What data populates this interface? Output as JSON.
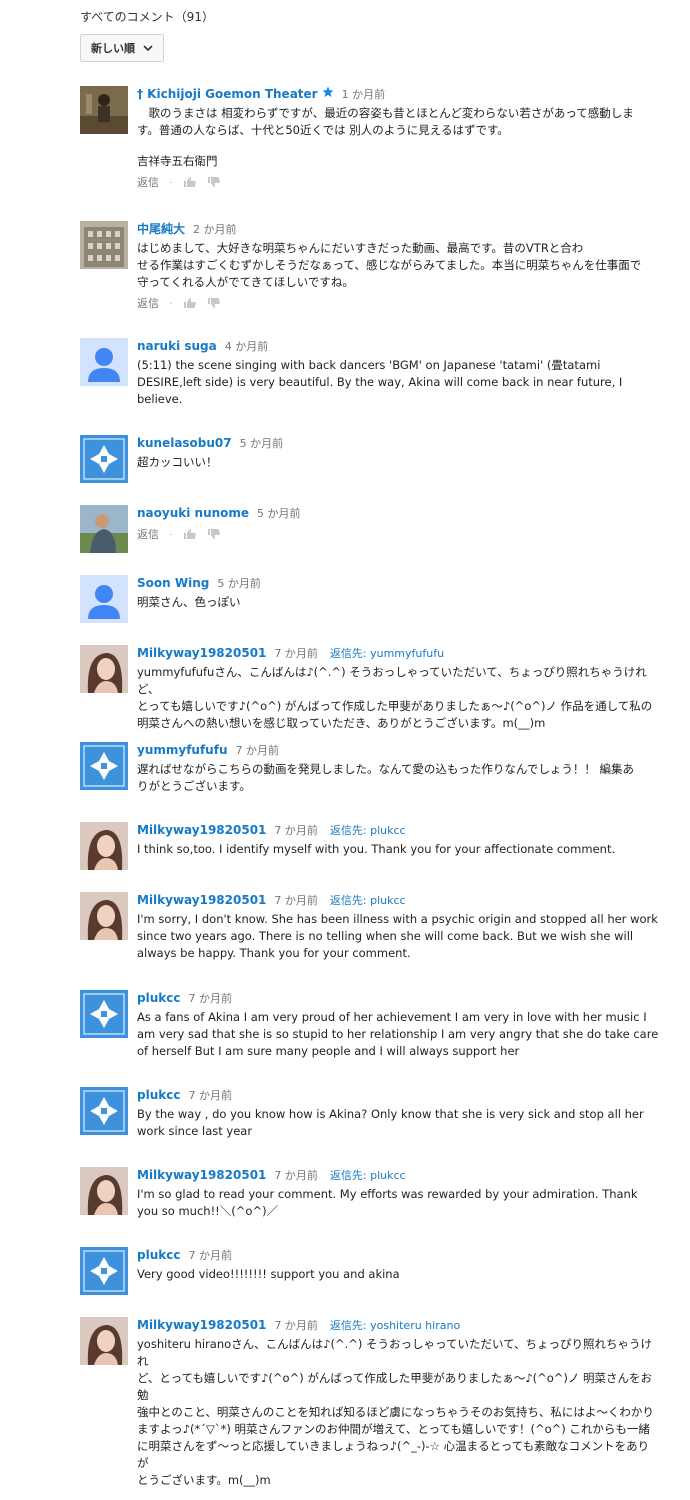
{
  "header": {
    "title": "すべてのコメント（91）"
  },
  "sort": {
    "label": "新しい順"
  },
  "actions": {
    "reply_label": "返信",
    "dot": "·"
  },
  "colors": {
    "link": "#167ac6",
    "avatar_blue": "#4285f4",
    "avatar_box": "#3e92dc"
  },
  "comments": [
    {
      "author": "† Kichijoji Goemon Theater",
      "time": "1 か月前",
      "avatar": "photo-stage",
      "lines": [
        "　歌のうまさは 相変わらずですが、最近の容姿も昔とほとんど変わらない若さがあって感動しま",
        "す。普通の人ならば、十代と50近くでは 別人のように見えるはずです。",
        "",
        "吉祥寺五右衛門"
      ]
    },
    {
      "author": "中尾純大",
      "time": "2 か月前",
      "avatar": "photo-building",
      "lines": [
        "はじめまして、大好きな明菜ちゃんにだいすきだった動画、最高です。昔のVTRと合わ",
        "せる作業はすごくむずかしそうだなぁって、感じながらみてました。本当に明菜ちゃんを仕事面で",
        "守ってくれる人がでてきてほしいですね。"
      ]
    },
    {
      "author": "naruki suga",
      "time": "4 か月前",
      "avatar": "default-user",
      "lines": [
        "(5:11) the scene singing with back dancers 'BGM' on Japanese 'tatami' (畳tatami",
        "DESIRE,left side) is very beautiful. By the way, Akina will come back in near future, I",
        "believe."
      ]
    },
    {
      "author": "kunelasobu07",
      "time": "5 か月前",
      "avatar": "default-box",
      "lines": [
        "超カッコいい！"
      ]
    },
    {
      "author": "naoyuki nunome",
      "time": "5 か月前",
      "avatar": "photo-outdoor",
      "lines": []
    },
    {
      "author": "Soon Wing",
      "time": "5 か月前",
      "avatar": "default-user",
      "lines": [
        "明菜さん、色っぽい"
      ]
    },
    {
      "author": "Milkyway19820501",
      "time": "7 か月前",
      "reply_to": "返信先: yummyfufufu",
      "avatar": "photo-portrait",
      "lines": [
        "yummyfufufuさん、こんばんは♪(^.^) そうおっしゃっていただいて、ちょっぴり照れちゃうけれど、",
        "とっても嬉しいです♪(^o^) がんばって作成した甲斐がありましたぁ〜♪(^o^)ノ 作品を通して私の",
        "明菜さんへの熱い想いを感じ取っていただき、ありがとうございます。m(__)m"
      ]
    },
    {
      "author": "yummyfufufu",
      "time": "7 か月前",
      "avatar": "default-box",
      "lines": [
        "遅ればせながらこちらの動画を発見しました。なんて愛の込もった作りなんでしょう！！ 編集あ",
        "りがとうございます。"
      ]
    },
    {
      "author": "Milkyway19820501",
      "time": "7 か月前",
      "reply_to": "返信先: plukcc",
      "avatar": "photo-portrait",
      "lines": [
        "I think so,too. I identify myself with you. Thank you for your affectionate comment."
      ]
    },
    {
      "author": "Milkyway19820501",
      "time": "7 か月前",
      "reply_to": "返信先: plukcc",
      "avatar": "photo-portrait",
      "lines": [
        "I'm sorry, I don't know. She has been illness with a psychic origin and stopped all her work",
        "since two years ago. There is no telling when she will come back. But we wish she will",
        "always be happy. Thank you for your comment."
      ]
    },
    {
      "author": "plukcc",
      "time": "7 か月前",
      "avatar": "default-box",
      "lines": [
        "As a fans of Akina I am very proud of her achievement I am very in love with her music I",
        "am very sad that she is so stupid to her relationship I am very angry that she do take care",
        "of herself But I am sure many people and I will always support her"
      ]
    },
    {
      "author": "plukcc",
      "time": "7 か月前",
      "avatar": "default-box",
      "lines": [
        "By the way , do you know how is Akina? Only know that she is very sick and stop all her",
        "work since last year"
      ]
    },
    {
      "author": "Milkyway19820501",
      "time": "7 か月前",
      "reply_to": "返信先: plukcc",
      "avatar": "photo-portrait",
      "lines": [
        "I'm so glad to read your comment. My efforts was rewarded by your admiration. Thank",
        "you so much!!＼(^o^)／"
      ]
    },
    {
      "author": "plukcc",
      "time": "7 か月前",
      "avatar": "default-box",
      "lines": [
        "Very good video!!!!!!!! support you and akina"
      ]
    },
    {
      "author": "Milkyway19820501",
      "time": "7 か月前",
      "reply_to": "返信先: yoshiteru hirano",
      "avatar": "photo-portrait",
      "lines": [
        "yoshiteru hiranoさん、こんばんは♪(^.^) そうおっしゃっていただいて、ちょっぴり照れちゃうけれ",
        "ど、とっても嬉しいです♪(^o^) がんばって作成した甲斐がありましたぁ〜♪(^o^)ノ 明菜さんをお勉",
        "強中とのこと、明菜さんのことを知れば知るほど虜になっちゃうそのお気持ち、私にはよ〜くわかり",
        "ますよっ♪(*´▽`*) 明菜さんファンのお仲間が増えて、とっても嬉しいです！(^o^) これからも一緒",
        "に明菜さんをず〜っと応援していきましょうねっ♪(^_-)-☆ 心温まるとっても素敵なコメントをありが",
        "とうございます。m(__)m"
      ]
    }
  ]
}
